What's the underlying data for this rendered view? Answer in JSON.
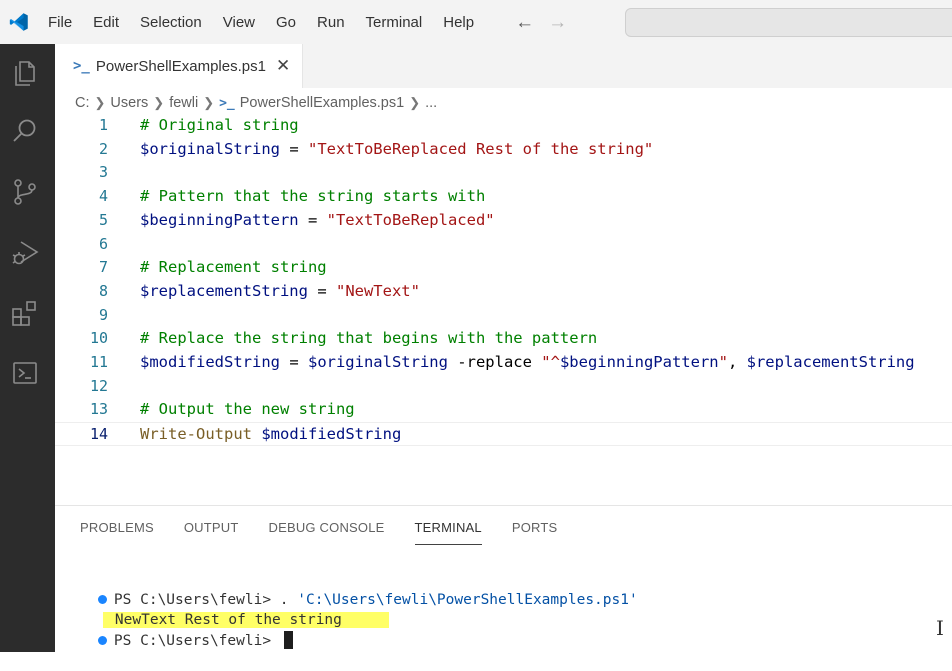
{
  "menu": [
    "File",
    "Edit",
    "Selection",
    "View",
    "Go",
    "Run",
    "Terminal",
    "Help"
  ],
  "nav": {
    "back_icon": "arrow-left-icon",
    "forward_icon": "arrow-right-icon"
  },
  "activity_bar": [
    "explorer-icon",
    "search-icon",
    "source-control-icon",
    "run-debug-icon",
    "extensions-icon",
    "terminal-panel-icon"
  ],
  "tab": {
    "icon": ">_",
    "label": "PowerShellExamples.ps1",
    "close": "✕"
  },
  "breadcrumb": {
    "drive": "C:",
    "users": "Users",
    "user": "fewli",
    "icon": ">_",
    "file": "PowerShellExamples.ps1",
    "more": "..."
  },
  "editor": {
    "lines": [
      {
        "n": "1",
        "tokens": [
          {
            "t": "# Original string",
            "c": "comment"
          }
        ]
      },
      {
        "n": "2",
        "tokens": [
          {
            "t": "$originalString",
            "c": "var"
          },
          {
            "t": " = ",
            "c": "op"
          },
          {
            "t": "\"TextToBeReplaced Rest of the string\"",
            "c": "str"
          }
        ]
      },
      {
        "n": "3",
        "tokens": []
      },
      {
        "n": "4",
        "tokens": [
          {
            "t": "# Pattern that the string starts with",
            "c": "comment"
          }
        ]
      },
      {
        "n": "5",
        "tokens": [
          {
            "t": "$beginningPattern",
            "c": "var"
          },
          {
            "t": " = ",
            "c": "op"
          },
          {
            "t": "\"TextToBeReplaced\"",
            "c": "str"
          }
        ]
      },
      {
        "n": "6",
        "tokens": []
      },
      {
        "n": "7",
        "tokens": [
          {
            "t": "# Replacement string",
            "c": "comment"
          }
        ]
      },
      {
        "n": "8",
        "tokens": [
          {
            "t": "$replacementString",
            "c": "var"
          },
          {
            "t": " = ",
            "c": "op"
          },
          {
            "t": "\"NewText\"",
            "c": "str"
          }
        ]
      },
      {
        "n": "9",
        "tokens": []
      },
      {
        "n": "10",
        "tokens": [
          {
            "t": "# Replace the string that begins with the pattern",
            "c": "comment"
          }
        ]
      },
      {
        "n": "11",
        "tokens": [
          {
            "t": "$modifiedString",
            "c": "var"
          },
          {
            "t": " = ",
            "c": "op"
          },
          {
            "t": "$originalString",
            "c": "var"
          },
          {
            "t": " -replace ",
            "c": "op"
          },
          {
            "t": "\"^",
            "c": "str"
          },
          {
            "t": "$beginningPattern",
            "c": "strvar"
          },
          {
            "t": "\"",
            "c": "str"
          },
          {
            "t": ", ",
            "c": "op"
          },
          {
            "t": "$replacementString",
            "c": "var"
          }
        ]
      },
      {
        "n": "12",
        "tokens": []
      },
      {
        "n": "13",
        "tokens": [
          {
            "t": "# Output the new string",
            "c": "comment"
          }
        ]
      },
      {
        "n": "14",
        "tokens": [
          {
            "t": "Write-Output",
            "c": "fn"
          },
          {
            "t": " ",
            "c": "op"
          },
          {
            "t": "$modifiedString",
            "c": "var"
          }
        ]
      }
    ],
    "active_line": "14"
  },
  "panel": {
    "tabs": [
      "PROBLEMS",
      "OUTPUT",
      "DEBUG CONSOLE",
      "TERMINAL",
      "PORTS"
    ],
    "active_tab": "TERMINAL",
    "terminal": {
      "line1_prompt": "PS C:\\Users\\fewli> . ",
      "line1_path": "'C:\\Users\\fewli\\PowerShellExamples.ps1'",
      "output": "NewText Rest of the string",
      "line3_prompt": "PS C:\\Users\\fewli> "
    }
  },
  "colors": {
    "accent": "#007acc",
    "activity_bar": "#2c2c2c",
    "highlight": "#ffff66",
    "terminal_dot": "#1a85ff"
  }
}
